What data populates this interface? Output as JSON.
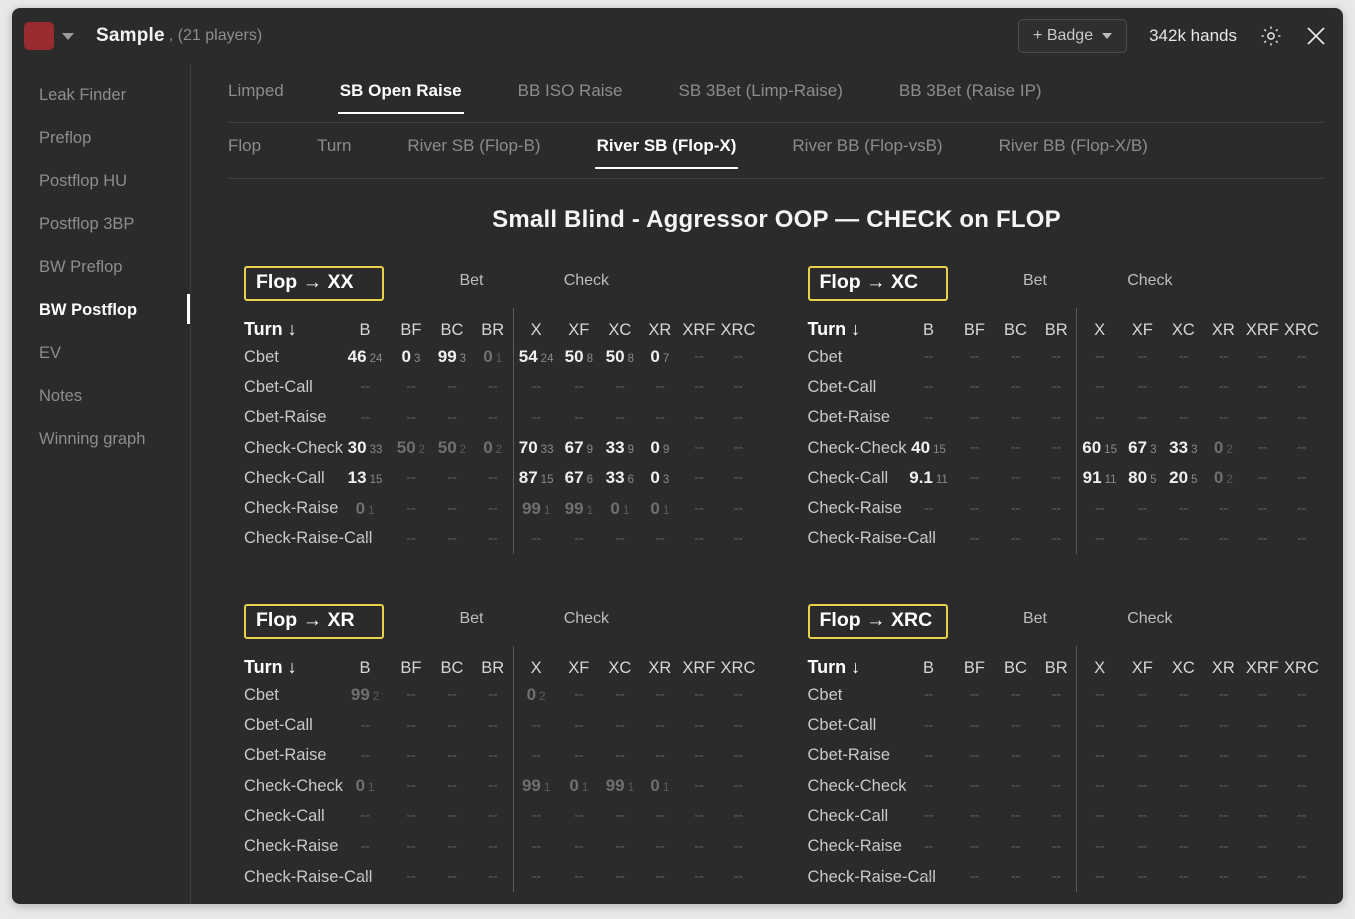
{
  "header": {
    "swatch_color": "#9a2c31",
    "project_name": "Sample",
    "players": ", (21 players)",
    "badge_label": "+ Badge",
    "hands": "342k hands",
    "gear_icon": "gear-icon",
    "close_icon": "close-icon"
  },
  "sidebar": {
    "items": [
      {
        "label": "Leak Finder",
        "active": false
      },
      {
        "label": "Preflop",
        "active": false
      },
      {
        "label": "Postflop HU",
        "active": false
      },
      {
        "label": "Postflop 3BP",
        "active": false
      },
      {
        "label": "BW Preflop",
        "active": false
      },
      {
        "label": "BW Postflop",
        "active": true
      },
      {
        "label": "EV",
        "active": false
      },
      {
        "label": "Notes",
        "active": false
      },
      {
        "label": "Winning graph",
        "active": false
      }
    ]
  },
  "tabs_primary": [
    {
      "label": "Limped",
      "active": false
    },
    {
      "label": "SB Open Raise",
      "active": true
    },
    {
      "label": "BB ISO Raise",
      "active": false
    },
    {
      "label": "SB 3Bet (Limp-Raise)",
      "active": false
    },
    {
      "label": "BB 3Bet (Raise IP)",
      "active": false
    }
  ],
  "tabs_secondary": [
    {
      "label": "Flop",
      "active": false
    },
    {
      "label": "Turn",
      "active": false
    },
    {
      "label": "River SB (Flop-B)",
      "active": false
    },
    {
      "label": "River SB (Flop-X)",
      "active": true
    },
    {
      "label": "River BB (Flop-vsB)",
      "active": false
    },
    {
      "label": "River BB (Flop-X/B)",
      "active": false
    }
  ],
  "main_title": "Small Blind - Aggressor OOP  —  CHECK on FLOP",
  "grid_common": {
    "group_bet": "Bet",
    "group_check": "Check",
    "turn_header": "Turn ↓",
    "bet_cols": [
      "B",
      "BF",
      "BC",
      "BR"
    ],
    "check_cols": [
      "X",
      "XF",
      "XC",
      "XR",
      "XRF",
      "XRC"
    ],
    "rows": [
      "Cbet",
      "Cbet-Call",
      "Cbet-Raise",
      "Check-Check",
      "Check-Call",
      "Check-Raise",
      "Check-Raise-Call"
    ],
    "na": "--"
  },
  "quadrants": [
    {
      "title": "Flop → XX",
      "cells": [
        [
          {
            "v": "46",
            "s": "24"
          },
          {
            "v": "0",
            "s": "3"
          },
          {
            "v": "99",
            "s": "3"
          },
          {
            "v": "0",
            "s": "1",
            "dim": true
          },
          {
            "v": "54",
            "s": "24"
          },
          {
            "v": "50",
            "s": "8"
          },
          {
            "v": "50",
            "s": "8"
          },
          {
            "v": "0",
            "s": "7"
          },
          {
            "na": true
          },
          {
            "na": true
          }
        ],
        [
          {
            "na": true
          },
          {
            "na": true
          },
          {
            "na": true
          },
          {
            "na": true
          },
          {
            "na": true
          },
          {
            "na": true
          },
          {
            "na": true
          },
          {
            "na": true
          },
          {
            "na": true
          },
          {
            "na": true
          }
        ],
        [
          {
            "na": true
          },
          {
            "na": true
          },
          {
            "na": true
          },
          {
            "na": true
          },
          {
            "na": true
          },
          {
            "na": true
          },
          {
            "na": true
          },
          {
            "na": true
          },
          {
            "na": true
          },
          {
            "na": true
          }
        ],
        [
          {
            "v": "30",
            "s": "33"
          },
          {
            "v": "50",
            "s": "2",
            "dim": true
          },
          {
            "v": "50",
            "s": "2",
            "dim": true
          },
          {
            "v": "0",
            "s": "2",
            "dim": true
          },
          {
            "v": "70",
            "s": "33"
          },
          {
            "v": "67",
            "s": "9"
          },
          {
            "v": "33",
            "s": "9"
          },
          {
            "v": "0",
            "s": "9"
          },
          {
            "na": true
          },
          {
            "na": true
          }
        ],
        [
          {
            "v": "13",
            "s": "15"
          },
          {
            "na": true
          },
          {
            "na": true
          },
          {
            "na": true
          },
          {
            "v": "87",
            "s": "15"
          },
          {
            "v": "67",
            "s": "6"
          },
          {
            "v": "33",
            "s": "6"
          },
          {
            "v": "0",
            "s": "3"
          },
          {
            "na": true
          },
          {
            "na": true
          }
        ],
        [
          {
            "v": "0",
            "s": "1",
            "dim": true
          },
          {
            "na": true
          },
          {
            "na": true
          },
          {
            "na": true
          },
          {
            "v": "99",
            "s": "1",
            "dim": true
          },
          {
            "v": "99",
            "s": "1",
            "dim": true
          },
          {
            "v": "0",
            "s": "1",
            "dim": true
          },
          {
            "v": "0",
            "s": "1",
            "dim": true
          },
          {
            "na": true
          },
          {
            "na": true
          }
        ],
        [
          {
            "na": true
          },
          {
            "na": true
          },
          {
            "na": true
          },
          {
            "na": true
          },
          {
            "na": true
          },
          {
            "na": true
          },
          {
            "na": true
          },
          {
            "na": true
          },
          {
            "na": true
          },
          {
            "na": true
          }
        ]
      ]
    },
    {
      "title": "Flop → XC",
      "cells": [
        [
          {
            "na": true
          },
          {
            "na": true
          },
          {
            "na": true
          },
          {
            "na": true
          },
          {
            "na": true
          },
          {
            "na": true
          },
          {
            "na": true
          },
          {
            "na": true
          },
          {
            "na": true
          },
          {
            "na": true
          }
        ],
        [
          {
            "na": true
          },
          {
            "na": true
          },
          {
            "na": true
          },
          {
            "na": true
          },
          {
            "na": true
          },
          {
            "na": true
          },
          {
            "na": true
          },
          {
            "na": true
          },
          {
            "na": true
          },
          {
            "na": true
          }
        ],
        [
          {
            "na": true
          },
          {
            "na": true
          },
          {
            "na": true
          },
          {
            "na": true
          },
          {
            "na": true
          },
          {
            "na": true
          },
          {
            "na": true
          },
          {
            "na": true
          },
          {
            "na": true
          },
          {
            "na": true
          }
        ],
        [
          {
            "v": "40",
            "s": "15"
          },
          {
            "na": true
          },
          {
            "na": true
          },
          {
            "na": true
          },
          {
            "v": "60",
            "s": "15"
          },
          {
            "v": "67",
            "s": "3"
          },
          {
            "v": "33",
            "s": "3"
          },
          {
            "v": "0",
            "s": "2",
            "dim": true
          },
          {
            "na": true
          },
          {
            "na": true
          }
        ],
        [
          {
            "v": "9.1",
            "s": "11"
          },
          {
            "na": true
          },
          {
            "na": true
          },
          {
            "na": true
          },
          {
            "v": "91",
            "s": "11"
          },
          {
            "v": "80",
            "s": "5"
          },
          {
            "v": "20",
            "s": "5"
          },
          {
            "v": "0",
            "s": "2",
            "dim": true
          },
          {
            "na": true
          },
          {
            "na": true
          }
        ],
        [
          {
            "na": true
          },
          {
            "na": true
          },
          {
            "na": true
          },
          {
            "na": true
          },
          {
            "na": true
          },
          {
            "na": true
          },
          {
            "na": true
          },
          {
            "na": true
          },
          {
            "na": true
          },
          {
            "na": true
          }
        ],
        [
          {
            "na": true
          },
          {
            "na": true
          },
          {
            "na": true
          },
          {
            "na": true
          },
          {
            "na": true
          },
          {
            "na": true
          },
          {
            "na": true
          },
          {
            "na": true
          },
          {
            "na": true
          },
          {
            "na": true
          }
        ]
      ]
    },
    {
      "title": "Flop → XR",
      "cells": [
        [
          {
            "v": "99",
            "s": "2",
            "dim": true
          },
          {
            "na": true
          },
          {
            "na": true
          },
          {
            "na": true
          },
          {
            "v": "0",
            "s": "2",
            "dim": true
          },
          {
            "na": true
          },
          {
            "na": true
          },
          {
            "na": true
          },
          {
            "na": true
          },
          {
            "na": true
          }
        ],
        [
          {
            "na": true
          },
          {
            "na": true
          },
          {
            "na": true
          },
          {
            "na": true
          },
          {
            "na": true
          },
          {
            "na": true
          },
          {
            "na": true
          },
          {
            "na": true
          },
          {
            "na": true
          },
          {
            "na": true
          }
        ],
        [
          {
            "na": true
          },
          {
            "na": true
          },
          {
            "na": true
          },
          {
            "na": true
          },
          {
            "na": true
          },
          {
            "na": true
          },
          {
            "na": true
          },
          {
            "na": true
          },
          {
            "na": true
          },
          {
            "na": true
          }
        ],
        [
          {
            "v": "0",
            "s": "1",
            "dim": true
          },
          {
            "na": true
          },
          {
            "na": true
          },
          {
            "na": true
          },
          {
            "v": "99",
            "s": "1",
            "dim": true
          },
          {
            "v": "0",
            "s": "1",
            "dim": true
          },
          {
            "v": "99",
            "s": "1",
            "dim": true
          },
          {
            "v": "0",
            "s": "1",
            "dim": true
          },
          {
            "na": true
          },
          {
            "na": true
          }
        ],
        [
          {
            "na": true
          },
          {
            "na": true
          },
          {
            "na": true
          },
          {
            "na": true
          },
          {
            "na": true
          },
          {
            "na": true
          },
          {
            "na": true
          },
          {
            "na": true
          },
          {
            "na": true
          },
          {
            "na": true
          }
        ],
        [
          {
            "na": true
          },
          {
            "na": true
          },
          {
            "na": true
          },
          {
            "na": true
          },
          {
            "na": true
          },
          {
            "na": true
          },
          {
            "na": true
          },
          {
            "na": true
          },
          {
            "na": true
          },
          {
            "na": true
          }
        ],
        [
          {
            "na": true
          },
          {
            "na": true
          },
          {
            "na": true
          },
          {
            "na": true
          },
          {
            "na": true
          },
          {
            "na": true
          },
          {
            "na": true
          },
          {
            "na": true
          },
          {
            "na": true
          },
          {
            "na": true
          }
        ]
      ]
    },
    {
      "title": "Flop → XRC",
      "cells": [
        [
          {
            "na": true
          },
          {
            "na": true
          },
          {
            "na": true
          },
          {
            "na": true
          },
          {
            "na": true
          },
          {
            "na": true
          },
          {
            "na": true
          },
          {
            "na": true
          },
          {
            "na": true
          },
          {
            "na": true
          }
        ],
        [
          {
            "na": true
          },
          {
            "na": true
          },
          {
            "na": true
          },
          {
            "na": true
          },
          {
            "na": true
          },
          {
            "na": true
          },
          {
            "na": true
          },
          {
            "na": true
          },
          {
            "na": true
          },
          {
            "na": true
          }
        ],
        [
          {
            "na": true
          },
          {
            "na": true
          },
          {
            "na": true
          },
          {
            "na": true
          },
          {
            "na": true
          },
          {
            "na": true
          },
          {
            "na": true
          },
          {
            "na": true
          },
          {
            "na": true
          },
          {
            "na": true
          }
        ],
        [
          {
            "na": true
          },
          {
            "na": true
          },
          {
            "na": true
          },
          {
            "na": true
          },
          {
            "na": true
          },
          {
            "na": true
          },
          {
            "na": true
          },
          {
            "na": true
          },
          {
            "na": true
          },
          {
            "na": true
          }
        ],
        [
          {
            "na": true
          },
          {
            "na": true
          },
          {
            "na": true
          },
          {
            "na": true
          },
          {
            "na": true
          },
          {
            "na": true
          },
          {
            "na": true
          },
          {
            "na": true
          },
          {
            "na": true
          },
          {
            "na": true
          }
        ],
        [
          {
            "na": true
          },
          {
            "na": true
          },
          {
            "na": true
          },
          {
            "na": true
          },
          {
            "na": true
          },
          {
            "na": true
          },
          {
            "na": true
          },
          {
            "na": true
          },
          {
            "na": true
          },
          {
            "na": true
          }
        ],
        [
          {
            "na": true
          },
          {
            "na": true
          },
          {
            "na": true
          },
          {
            "na": true
          },
          {
            "na": true
          },
          {
            "na": true
          },
          {
            "na": true
          },
          {
            "na": true
          },
          {
            "na": true
          },
          {
            "na": true
          }
        ]
      ]
    }
  ]
}
